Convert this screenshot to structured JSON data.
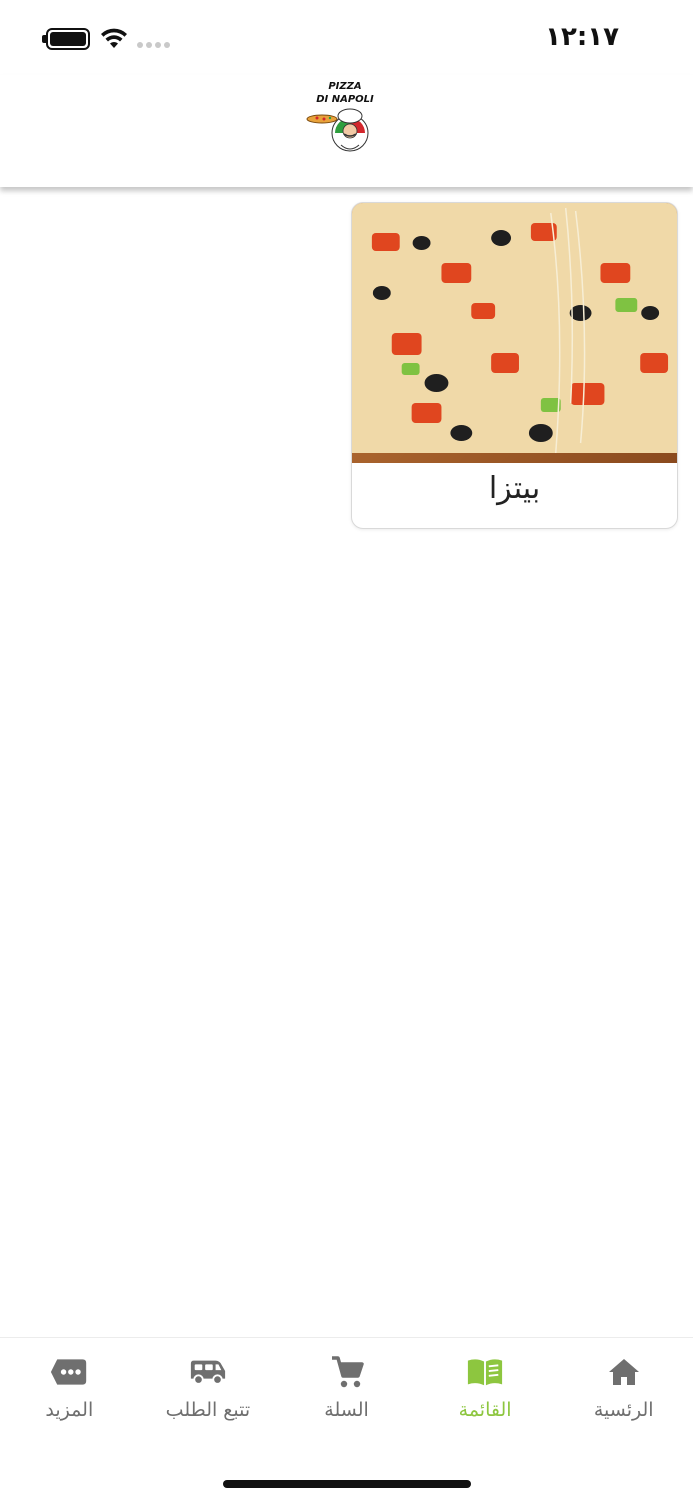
{
  "status_bar": {
    "time": "١٢:١٧",
    "battery_icon": "battery-full-icon",
    "wifi_icon": "wifi-icon",
    "signal_icon": "cellular-signal-dots-icon"
  },
  "header": {
    "logo_line1": "PIZZA",
    "logo_line2": "DI NAPOLI"
  },
  "categories": [
    {
      "title": "بيتزا",
      "image": "pizza-slice-photo"
    }
  ],
  "tab_bar": {
    "active_color": "#8dc63f",
    "inactive_color": "#6f6f6f",
    "tabs": [
      {
        "label": "الرئسية",
        "icon": "home-icon",
        "active": false
      },
      {
        "label": "القائمة",
        "icon": "menu-book-icon",
        "active": true
      },
      {
        "label": "السلة",
        "icon": "cart-icon",
        "active": false
      },
      {
        "label": "تتبع الطلب",
        "icon": "delivery-van-icon",
        "active": false
      },
      {
        "label": "المزيد",
        "icon": "more-dots-icon",
        "active": false
      }
    ]
  }
}
